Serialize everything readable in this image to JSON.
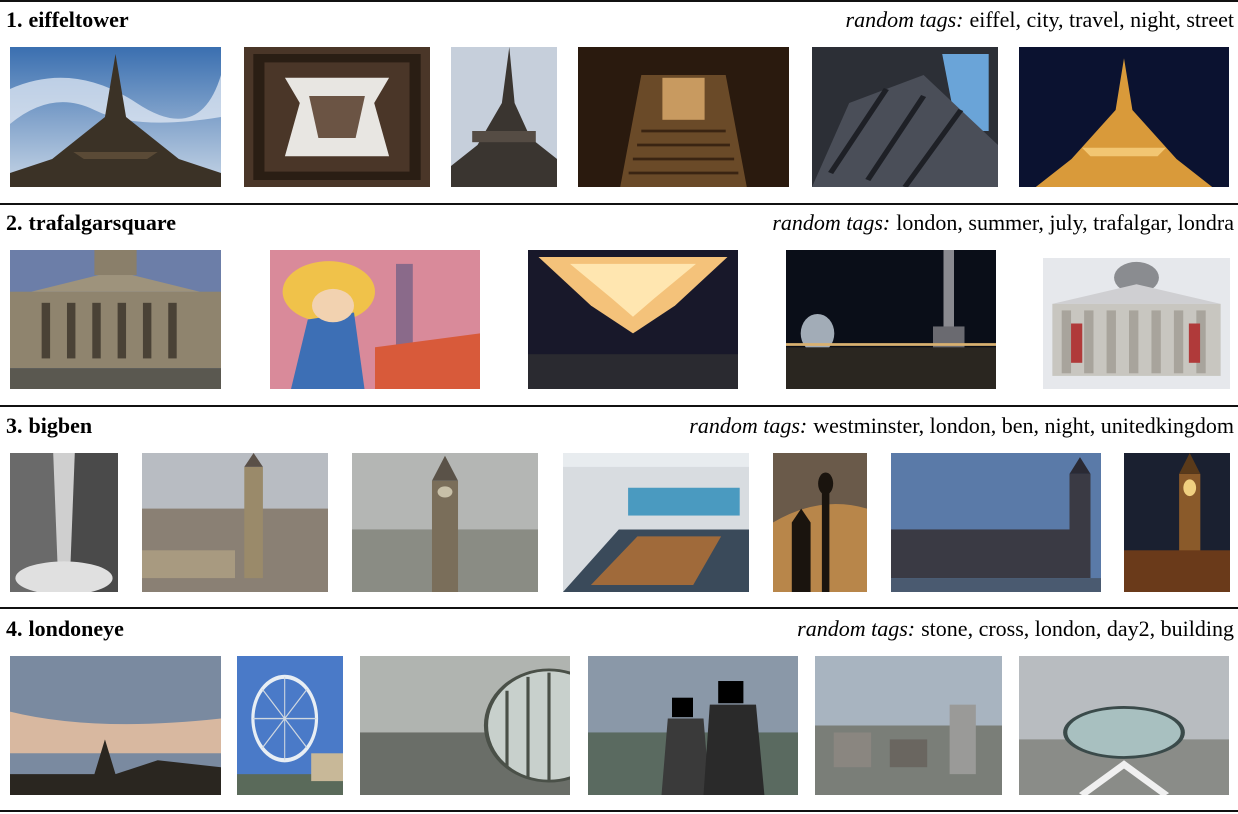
{
  "rows": [
    {
      "number": "1.",
      "name": "eiffeltower",
      "tags_label": "random tags:",
      "tags": "eiffel, city, travel, night, street",
      "photos": [
        "eiffel tower from below, cloudy sky",
        "looking up through tower center",
        "tower leg against sky",
        "stairs inside tower",
        "tower ironwork and sky",
        "tower lit at night"
      ]
    },
    {
      "number": "2.",
      "name": "trafalgarsquare",
      "tags_label": "random tags:",
      "tags": "london, summer, july, trafalgar, londra",
      "photos": [
        "national gallery facade at dusk",
        "colorful painted mural",
        "chandelier glowing in dark room",
        "nelson's column at night with fountain",
        "national gallery portico"
      ]
    },
    {
      "number": "3.",
      "name": "bigben",
      "tags_label": "random tags:",
      "tags": "westminster, london, ben, night, unitedkingdom",
      "photos": [
        "black and white street scene",
        "aerial view of big ben",
        "big ben in haze",
        "conference room with table",
        "silhouette of lamp post at sunset",
        "houses of parliament at dusk",
        "big ben tower lit at night"
      ]
    },
    {
      "number": "4.",
      "name": "londoneye",
      "tags_label": "random tags:",
      "tags": "stone, cross, london,  day2, building",
      "photos": [
        "london skyline at sunset",
        "london eye wheel",
        "london eye capsule over city",
        "two people in capsule with faces covered",
        "city skyline from above",
        "capsule with city view"
      ]
    }
  ]
}
